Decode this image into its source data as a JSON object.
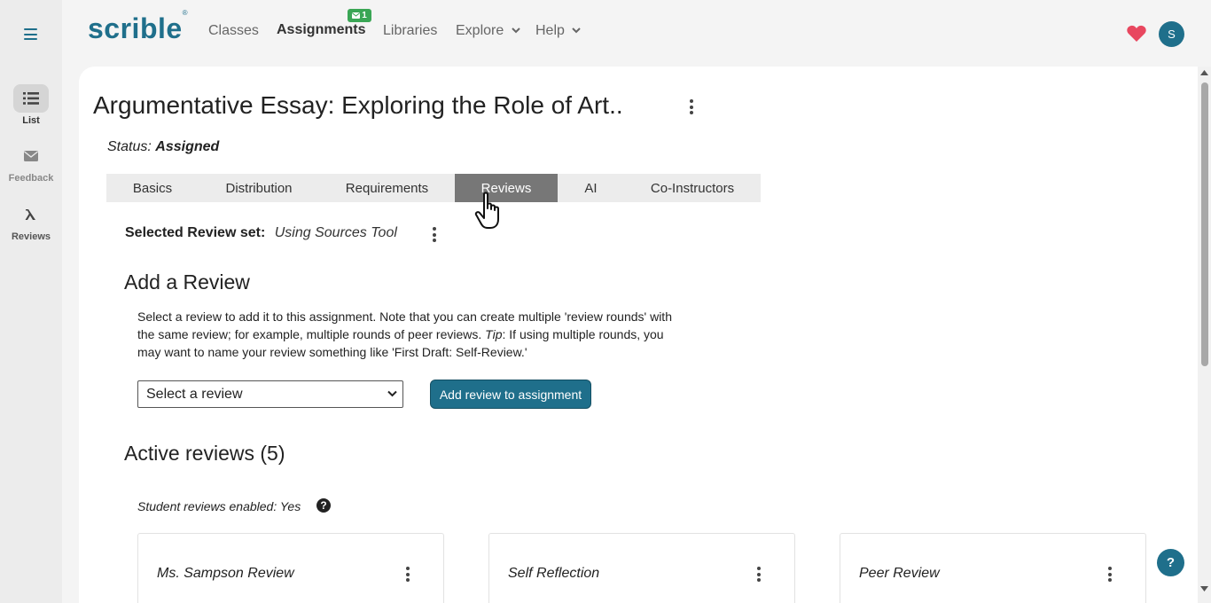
{
  "rail": {
    "items": [
      {
        "label": "List",
        "icon": "list-icon"
      },
      {
        "label": "Feedback",
        "icon": "envelope-icon"
      },
      {
        "label": "Reviews",
        "icon": "lambda-icon"
      }
    ]
  },
  "nav": {
    "logo": "scrible",
    "logo_mark": "®",
    "links": [
      "Classes",
      "Assignments",
      "Libraries",
      "Explore",
      "Help"
    ],
    "badge_count": "1",
    "avatar_initial": "S",
    "colors": {
      "brand": "#1f6f8b",
      "badge": "#3aa655",
      "heart": "#e8475f"
    }
  },
  "page": {
    "title": "Argumentative Essay: Exploring the Role of Art...",
    "status_label": "Status:",
    "status_value": "Assigned",
    "tabs": [
      "Basics",
      "Distribution",
      "Requirements",
      "Reviews",
      "AI",
      "Co-Instructors"
    ],
    "active_tab": "Reviews",
    "review_set_label": "Selected Review set:",
    "review_set_value": "Using Sources Tool",
    "add_review_heading": "Add a Review",
    "add_review_desc_1": "Select a review to add it to this assignment. Note that you can create multiple 'review rounds' with the same review; for example, multiple rounds of peer reviews. ",
    "add_review_tip": "Tip",
    "add_review_desc_2": ": If using multiple rounds, you may want to name your review something like 'First Draft: Self-Review.'",
    "select_placeholder": "Select a review",
    "add_button": "Add review to assignment",
    "active_heading": "Active reviews (5)",
    "student_reviews": "Student reviews enabled: Yes",
    "question_glyph": "?",
    "cards": [
      "Ms. Sampson Review",
      "Self Reflection",
      "Peer Review"
    ],
    "help_glyph": "?"
  }
}
